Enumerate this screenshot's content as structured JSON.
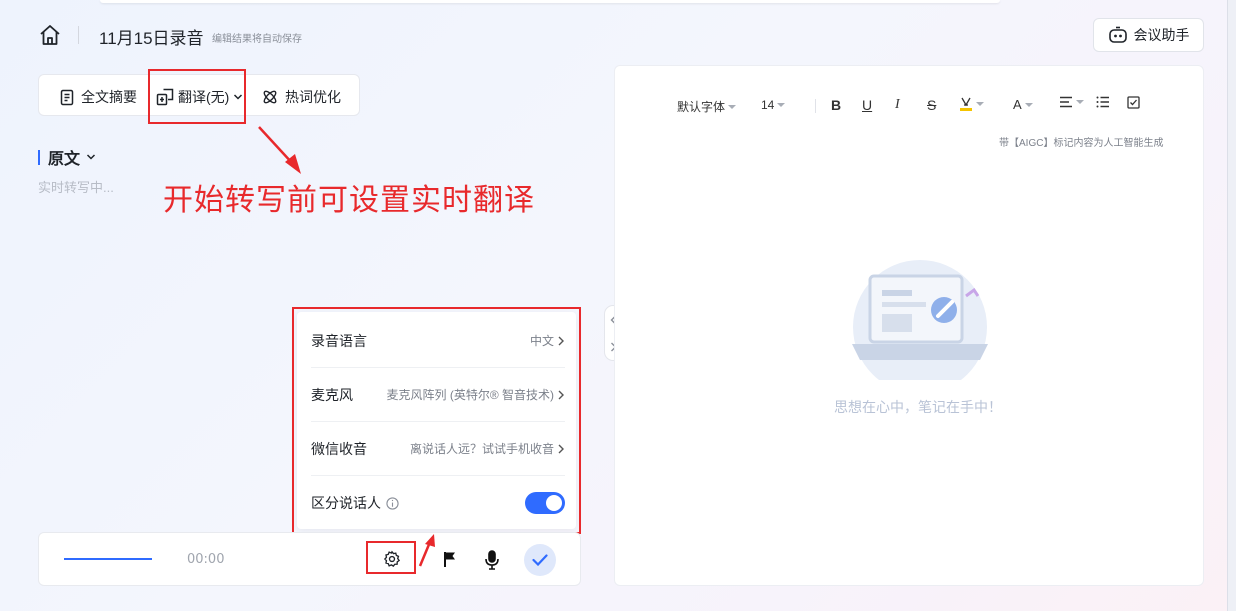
{
  "header": {
    "title": "11月15日录音",
    "autosave_note": "编辑结果将自动保存",
    "assistant_label": "会议助手"
  },
  "toolbar": {
    "summary_label": "全文摘要",
    "translate_label": "翻译(无)",
    "hotword_label": "热词优化"
  },
  "content": {
    "original_label": "原文",
    "transcribing_placeholder": "实时转写中..."
  },
  "annotation": {
    "text": "开始转写前可设置实时翻译"
  },
  "settings": {
    "rows": [
      {
        "label": "录音语言",
        "value": "中文"
      },
      {
        "label": "麦克风",
        "value": "麦克风阵列 (英特尔® 智音技术)"
      },
      {
        "label": "微信收音",
        "value": "离说话人远？试试手机收音"
      },
      {
        "label": "区分说话人",
        "value": ""
      }
    ],
    "speaker_toggle_on": true
  },
  "recorder": {
    "time": "00:00"
  },
  "editor": {
    "font_label": "默认字体",
    "size_label": "14",
    "bold": "B",
    "underline": "U",
    "italic": "I",
    "strike": "S",
    "font_color": "A",
    "aigc_note": "带【AIGC】标记内容为人工智能生成",
    "empty_text": "思想在心中，笔记在手中！"
  },
  "colors": {
    "accent": "#2f6bff",
    "annotation_red": "#e8292c"
  }
}
